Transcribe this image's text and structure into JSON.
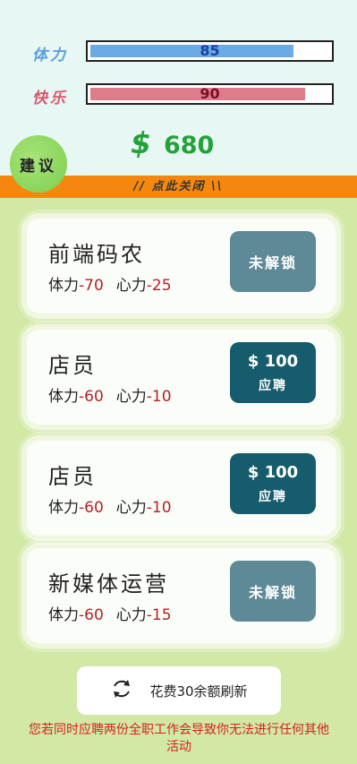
{
  "stats": {
    "stamina": {
      "label": "体力",
      "value": "85",
      "fill": 0.85,
      "color": "#6aabe5",
      "text_color": "#1a3fa5"
    },
    "happiness": {
      "label": "快乐",
      "value": "90",
      "fill": 0.9,
      "color": "#de7c8c",
      "text_color": "#7a1025"
    }
  },
  "money": {
    "symbol": "$",
    "amount": "680"
  },
  "advice_button": "建议",
  "close_bar": "// 点此关闭 \\\\",
  "jobs": [
    {
      "title": "前端码农",
      "stamina_label": "体力",
      "stamina": "-70",
      "mind_label": "心力",
      "mind": "-25",
      "button": "未解锁",
      "locked": true
    },
    {
      "title": "店员",
      "stamina_label": "体力",
      "stamina": "-60",
      "mind_label": "心力",
      "mind": "-10",
      "price": "$ 100",
      "apply": "应聘",
      "locked": false
    },
    {
      "title": "店员",
      "stamina_label": "体力",
      "stamina": "-60",
      "mind_label": "心力",
      "mind": "-10",
      "price": "$ 100",
      "apply": "应聘",
      "locked": false
    },
    {
      "title": "新媒体运营",
      "stamina_label": "体力",
      "stamina": "-60",
      "mind_label": "心力",
      "mind": "-15",
      "button": "未解锁",
      "locked": true
    }
  ],
  "refresh": {
    "label": "花费30余额刷新",
    "icon": "refresh-icon"
  },
  "warning": "您若同时应聘两份全职工作会导致你无法进行任何其他活动"
}
